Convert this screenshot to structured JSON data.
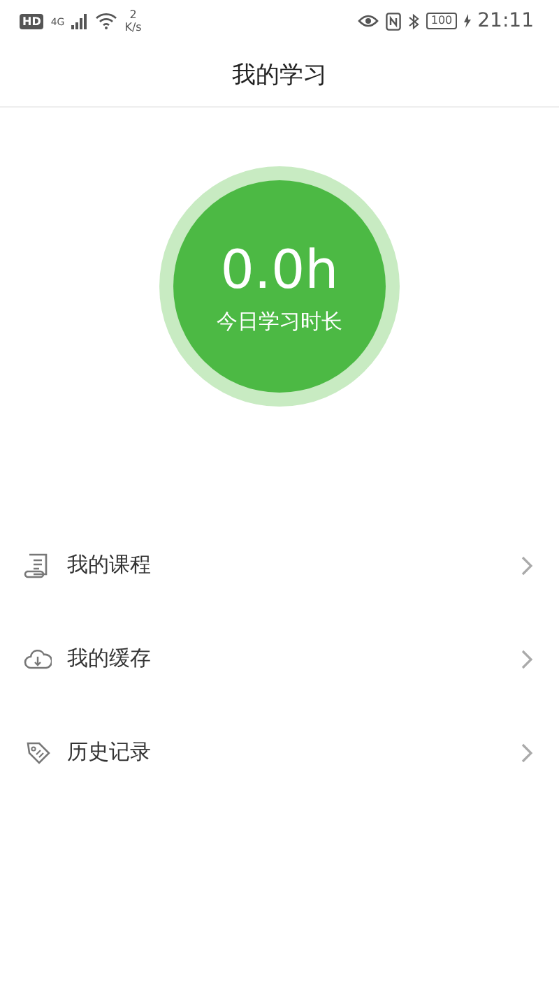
{
  "status_bar": {
    "hd": "HD",
    "network": "4G",
    "speed_value": "2",
    "speed_unit": "K/s",
    "battery": "100",
    "time": "21:11"
  },
  "header": {
    "title": "我的学习"
  },
  "today": {
    "value": "0.0h",
    "label": "今日学习时长"
  },
  "menu": [
    {
      "kind": "course",
      "label": "我的课程"
    },
    {
      "kind": "cache",
      "label": "我的缓存"
    },
    {
      "kind": "history",
      "label": "历史记录"
    }
  ]
}
